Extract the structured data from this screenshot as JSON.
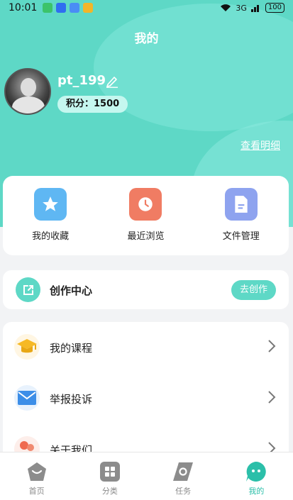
{
  "status_bar": {
    "time": "10:01",
    "network": "3G",
    "battery": "100"
  },
  "header": {
    "title": "我的"
  },
  "profile": {
    "username": "pt_199",
    "points_label": "积分：1500",
    "view_detail": "查看明细"
  },
  "quick_actions": [
    {
      "label": "我的收藏",
      "icon": "star-icon",
      "color": "#5fb7f3"
    },
    {
      "label": "最近浏览",
      "icon": "clock-icon",
      "color": "#f07c63"
    },
    {
      "label": "文件管理",
      "icon": "document-icon",
      "color": "#8ea3ef"
    }
  ],
  "creation": {
    "title": "创作中心",
    "button": "去创作"
  },
  "menu": [
    {
      "label": "我的课程",
      "icon": "graduation-cap-icon"
    },
    {
      "label": "举报投诉",
      "icon": "envelope-icon"
    },
    {
      "label": "关于我们",
      "icon": "people-icon"
    }
  ],
  "bottom_nav": [
    {
      "label": "首页",
      "icon": "home-icon",
      "active": false
    },
    {
      "label": "分类",
      "icon": "grid-icon",
      "active": false
    },
    {
      "label": "任务",
      "icon": "task-icon",
      "active": false
    },
    {
      "label": "我的",
      "icon": "chat-bubble-icon",
      "active": true
    }
  ],
  "colors": {
    "accent": "#5ed8c6",
    "accent_text": "#2bbfa9",
    "background": "#f2f3f5"
  }
}
